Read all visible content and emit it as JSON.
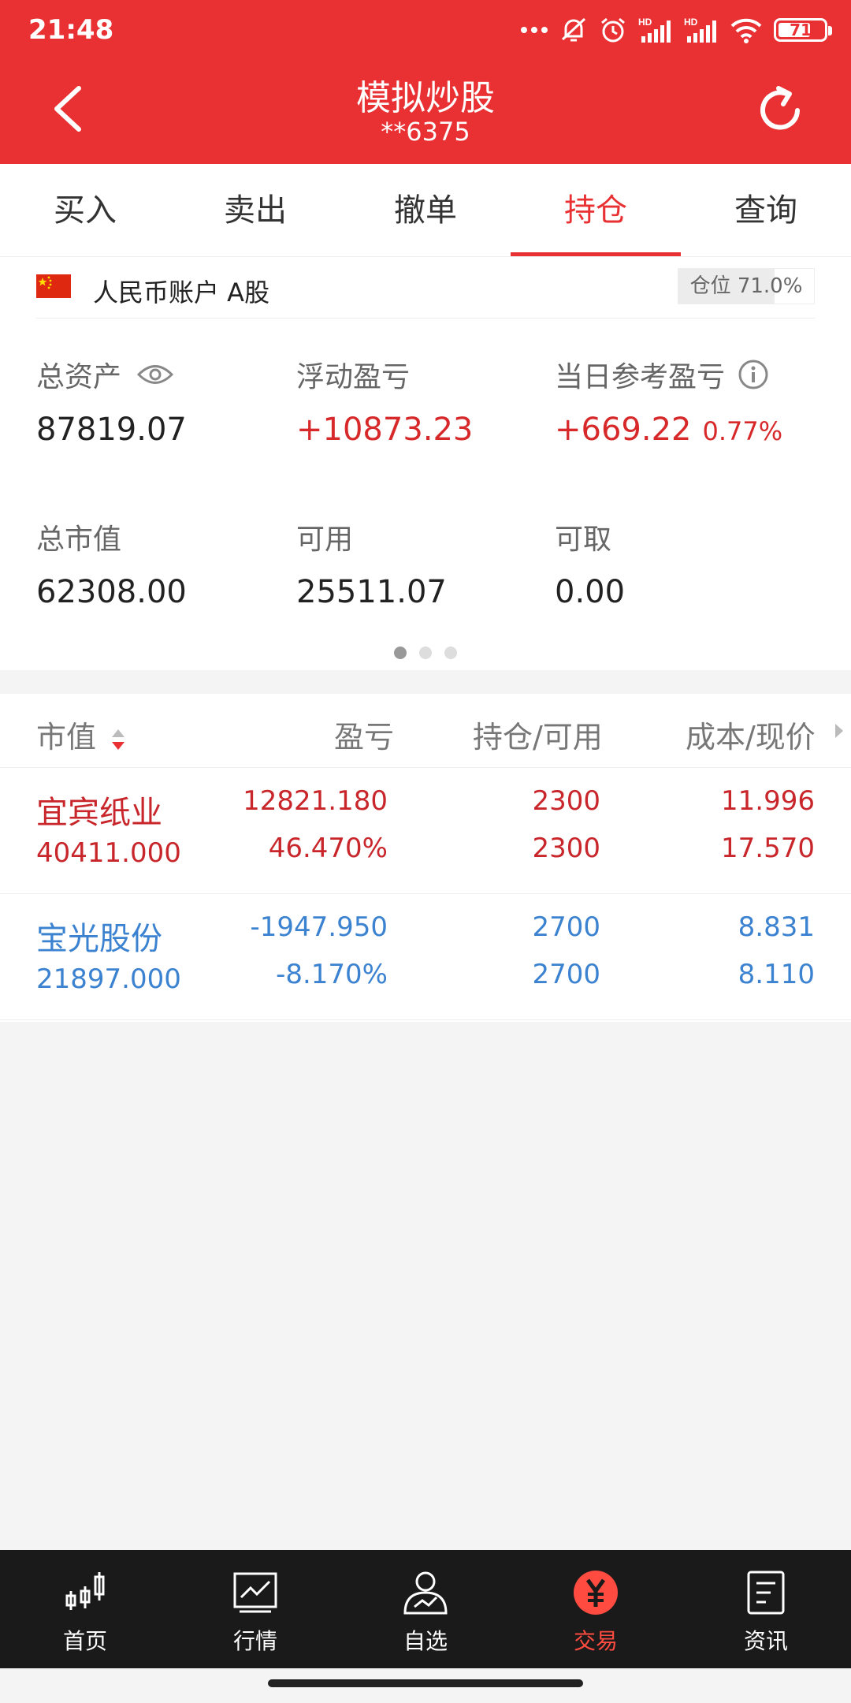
{
  "status_bar": {
    "time": "21:48",
    "battery": "71",
    "battery_level": 0.71,
    "network_badge": "HD"
  },
  "header": {
    "title": "模拟炒股",
    "account": "**6375"
  },
  "tabs": [
    {
      "label": "买入",
      "active": false
    },
    {
      "label": "卖出",
      "active": false
    },
    {
      "label": "撤单",
      "active": false
    },
    {
      "label": "持仓",
      "active": true
    },
    {
      "label": "查询",
      "active": false
    }
  ],
  "account": {
    "label": "人民币账户 A股",
    "position_label": "仓位 71.0%",
    "position_level": 0.71
  },
  "metrics": {
    "total_assets": {
      "label": "总资产",
      "value": "87819.07"
    },
    "floating_pl": {
      "label": "浮动盈亏",
      "value": "+10873.23"
    },
    "daily_pl": {
      "label": "当日参考盈亏",
      "value": "+669.22",
      "pct": "0.77%"
    },
    "market_value": {
      "label": "总市值",
      "value": "62308.00"
    },
    "available": {
      "label": "可用",
      "value": "25511.07"
    },
    "withdrawable": {
      "label": "可取",
      "value": "0.00"
    }
  },
  "holdings": {
    "headers": {
      "market_value": "市值",
      "pl": "盈亏",
      "position": "持仓/可用",
      "cost_price": "成本/现价"
    },
    "rows": [
      {
        "name": "宜宾纸业",
        "market_value": "40411.000",
        "pl": "12821.180",
        "pl_pct": "46.470%",
        "position": "2300",
        "available": "2300",
        "cost": "11.996",
        "price": "17.570",
        "trend": "up"
      },
      {
        "name": "宝光股份",
        "market_value": "21897.000",
        "pl": "-1947.950",
        "pl_pct": "-8.170%",
        "position": "2700",
        "available": "2700",
        "cost": "8.831",
        "price": "8.110",
        "trend": "down"
      }
    ]
  },
  "colors": {
    "brand_red": "#e93033",
    "gain": "#c8262b",
    "loss": "#3b82d0",
    "nav_bg": "#1a1a1a"
  },
  "bottom_nav": [
    {
      "label": "首页",
      "icon": "candlestick-icon",
      "active": false
    },
    {
      "label": "行情",
      "icon": "market-chart-icon",
      "active": false
    },
    {
      "label": "自选",
      "icon": "watchlist-user-icon",
      "active": false
    },
    {
      "label": "交易",
      "icon": "yuan-trade-icon",
      "active": true
    },
    {
      "label": "资讯",
      "icon": "news-document-icon",
      "active": false
    }
  ]
}
